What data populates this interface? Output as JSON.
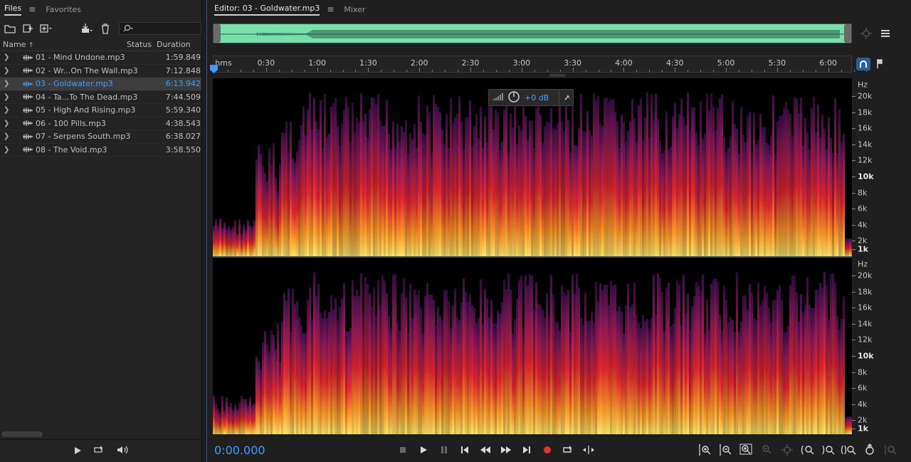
{
  "left_panel": {
    "tabs": [
      "Files",
      "Favorites"
    ],
    "columns": {
      "name": "Name",
      "status": "Status",
      "duration": "Duration"
    },
    "files": [
      {
        "name": "01 - Mind Undone.mp3",
        "duration": "1:59.849"
      },
      {
        "name": "02 - Wr...On The Wall.mp3",
        "duration": "7:12.848"
      },
      {
        "name": "03 - Goldwater.mp3",
        "duration": "6:13.942",
        "selected": true
      },
      {
        "name": "04 - Ta...To The Dead.mp3",
        "duration": "7:44.509"
      },
      {
        "name": "05 - High And Rising.mp3",
        "duration": "5:59.340"
      },
      {
        "name": "06 - 100 Pills.mp3",
        "duration": "4:38.543"
      },
      {
        "name": "07 - Serpens South.mp3",
        "duration": "6:38.027"
      },
      {
        "name": "08 - The Void.mp3",
        "duration": "3:58.550"
      }
    ]
  },
  "editor": {
    "tabs": [
      "Editor: 03 - Goldwater.mp3",
      "Mixer"
    ],
    "ruler": {
      "start_label": "hms",
      "labels": [
        "0:30",
        "1:00",
        "1:30",
        "2:00",
        "2:30",
        "3:00",
        "3:30",
        "4:00",
        "4:30",
        "5:00",
        "5:30",
        "6:00"
      ]
    },
    "hz_scale": {
      "unit": "Hz",
      "labels": [
        "20k",
        "18k",
        "16k",
        "14k",
        "12k",
        "10k",
        "8k",
        "6k",
        "4k",
        "2k",
        "1k"
      ]
    },
    "hud": {
      "gain": "+0 dB"
    },
    "current_time": "0:00.000"
  },
  "colors": {
    "accent": "#3e9dff",
    "overview": "#76dfae"
  }
}
